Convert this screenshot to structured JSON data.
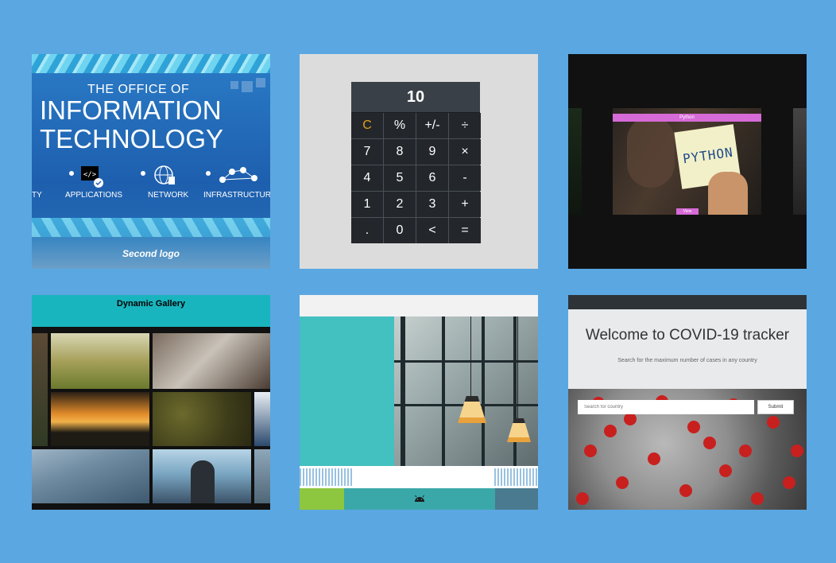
{
  "page": {
    "background": "#5ba7e1"
  },
  "cards": [
    {
      "id": "it-office",
      "title_line1": "THE OFFICE OF",
      "title_line2": "INFORMATION",
      "title_line3": "TECHNOLOGY",
      "labels": [
        "TY",
        "APPLICATIONS",
        "NETWORK",
        "INFRASTRUCTURE"
      ],
      "caption": "Second logo"
    },
    {
      "id": "calculator",
      "display": "10",
      "keys": [
        "C",
        "%",
        "+/-",
        "÷",
        "7",
        "8",
        "9",
        "×",
        "4",
        "5",
        "6",
        "-",
        "1",
        "2",
        "3",
        "+",
        ".",
        "0",
        "<",
        "="
      ]
    },
    {
      "id": "python-slider",
      "slide_title": "Python",
      "note_text": "PYTHON",
      "button": "View"
    },
    {
      "id": "dynamic-gallery",
      "title": "Dynamic Gallery"
    },
    {
      "id": "android-site",
      "footer_icon": "android-icon"
    },
    {
      "id": "covid-tracker",
      "heading": "Welcome to COVID-19 tracker",
      "subheading": "Search for the maximum number of cases in any country",
      "search_placeholder": "Search for country",
      "submit_label": "Submit"
    }
  ]
}
